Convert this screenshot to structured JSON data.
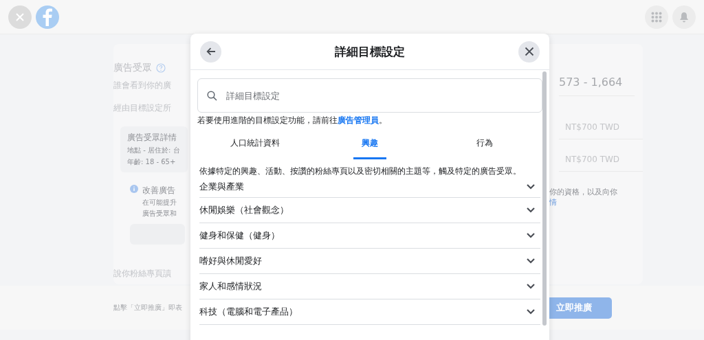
{
  "background": {
    "audience_title": "廣告受眾",
    "audience_question": "誰會看到你的廣",
    "audience_note": "經由目標設定所",
    "details_title": "廣告受眾詳情",
    "details_location": "地點 - 居住於: 台",
    "details_age": "年齡: 18 - 65+",
    "tip_title": "改善廣告",
    "tip_line_1": "在可能提升",
    "tip_line_2": "廣告受眾和",
    "fans_text": "說你粉絲專頁讀",
    "reach": "573 - 1,664",
    "budget_1": "NT$700 TWD",
    "budget_2": "NT$700 TWD",
    "policy_line": "你的資格，以及向你",
    "policy_link": "情",
    "footer_text": "點擊「立即推廣」即表",
    "promote_button": "立即推廣"
  },
  "modal": {
    "title": "詳細目標設定",
    "search": {
      "placeholder": "詳細目標設定"
    },
    "note": "若要使用進階的目標設定功能，請前往",
    "note_link": "廣告管理員",
    "note_end": "。",
    "tabs": [
      {
        "label": "人口統計資料",
        "selected": false
      },
      {
        "label": "興趣",
        "selected": true
      },
      {
        "label": "行為",
        "selected": false
      }
    ],
    "description": "依據特定的興趣、活動、按讚的粉絲專頁以及密切相關的主題等，觸及特定的廣告受眾。",
    "categories": [
      {
        "label": "企業與產業",
        "expanded": false
      },
      {
        "label": "休閒娛樂（社會觀念）",
        "expanded": false
      },
      {
        "label": "健身和保健（健身）",
        "expanded": false
      },
      {
        "label": "嗜好與休閒愛好",
        "expanded": false
      },
      {
        "label": "家人和感情狀況",
        "expanded": false
      },
      {
        "label": "科技（電腦和電子產品）",
        "expanded": false
      }
    ]
  }
}
